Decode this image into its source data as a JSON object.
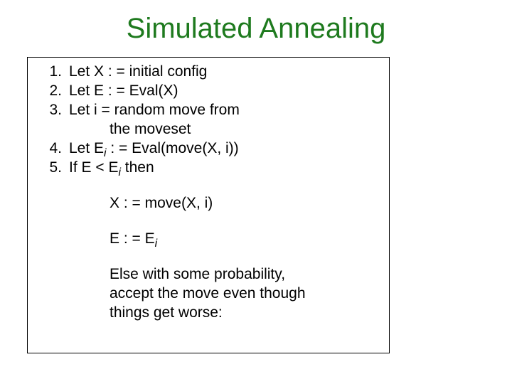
{
  "title": {
    "text": "Simulated Annealing",
    "color": "#1E7A1E"
  },
  "algo": {
    "l1_num": "1.",
    "l1_txt": "Let X : = initial config",
    "l2_num": "2.",
    "l2_txt": "Let E : = Eval(X)",
    "l3_num": "3.",
    "l3_txt": "Let i = random move from",
    "l3b_txt": "the moveset",
    "l4_num": "4.",
    "l4_pre": "Let E",
    "l4_sub": "i",
    "l4_post": " : = Eval(move(X, i))",
    "l5_num": "5.",
    "l5_pre": "If E < E",
    "l5_sub": "i",
    "l5_post": " then",
    "b1": "X : = move(X, i)",
    "b2_pre": "E : = E",
    "b2_sub": "i",
    "b3a": "Else with some probability,",
    "b3b": "accept the move even though",
    "b3c": "things get worse:"
  }
}
